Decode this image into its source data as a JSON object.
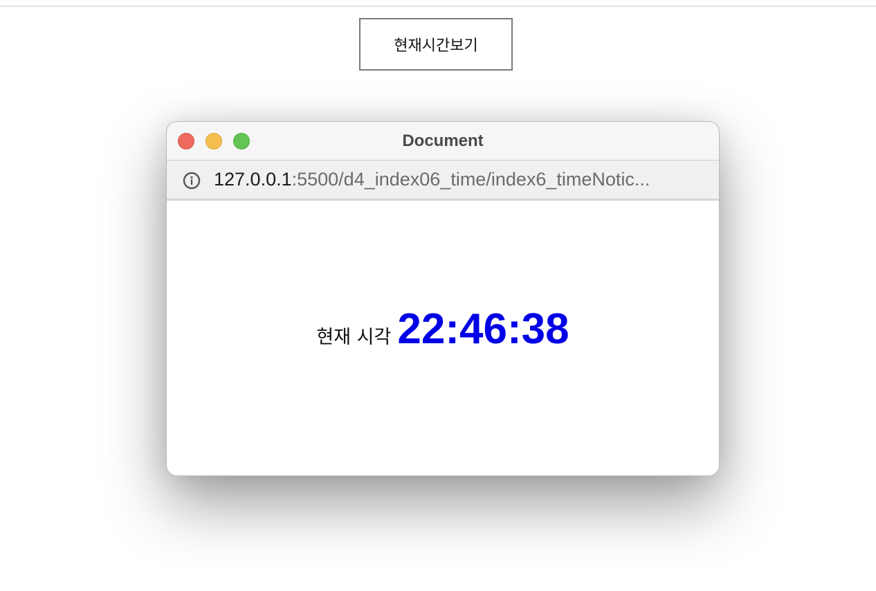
{
  "page": {
    "button_label": "현재시간보기"
  },
  "popup": {
    "title": "Document",
    "url_host": "127.0.0.1",
    "url_rest": ":5500/d4_index06_time/index6_timeNotic...",
    "icons": {
      "info": "info-icon",
      "close": "close-icon",
      "minimize": "minimize-icon",
      "zoom": "zoom-icon"
    },
    "content": {
      "label": "현재 시각",
      "time": "22:46:38"
    }
  },
  "colors": {
    "time_text": "#0000e6",
    "close": "#ee6a5f",
    "minimize": "#f5be4f",
    "zoom": "#62c554"
  }
}
